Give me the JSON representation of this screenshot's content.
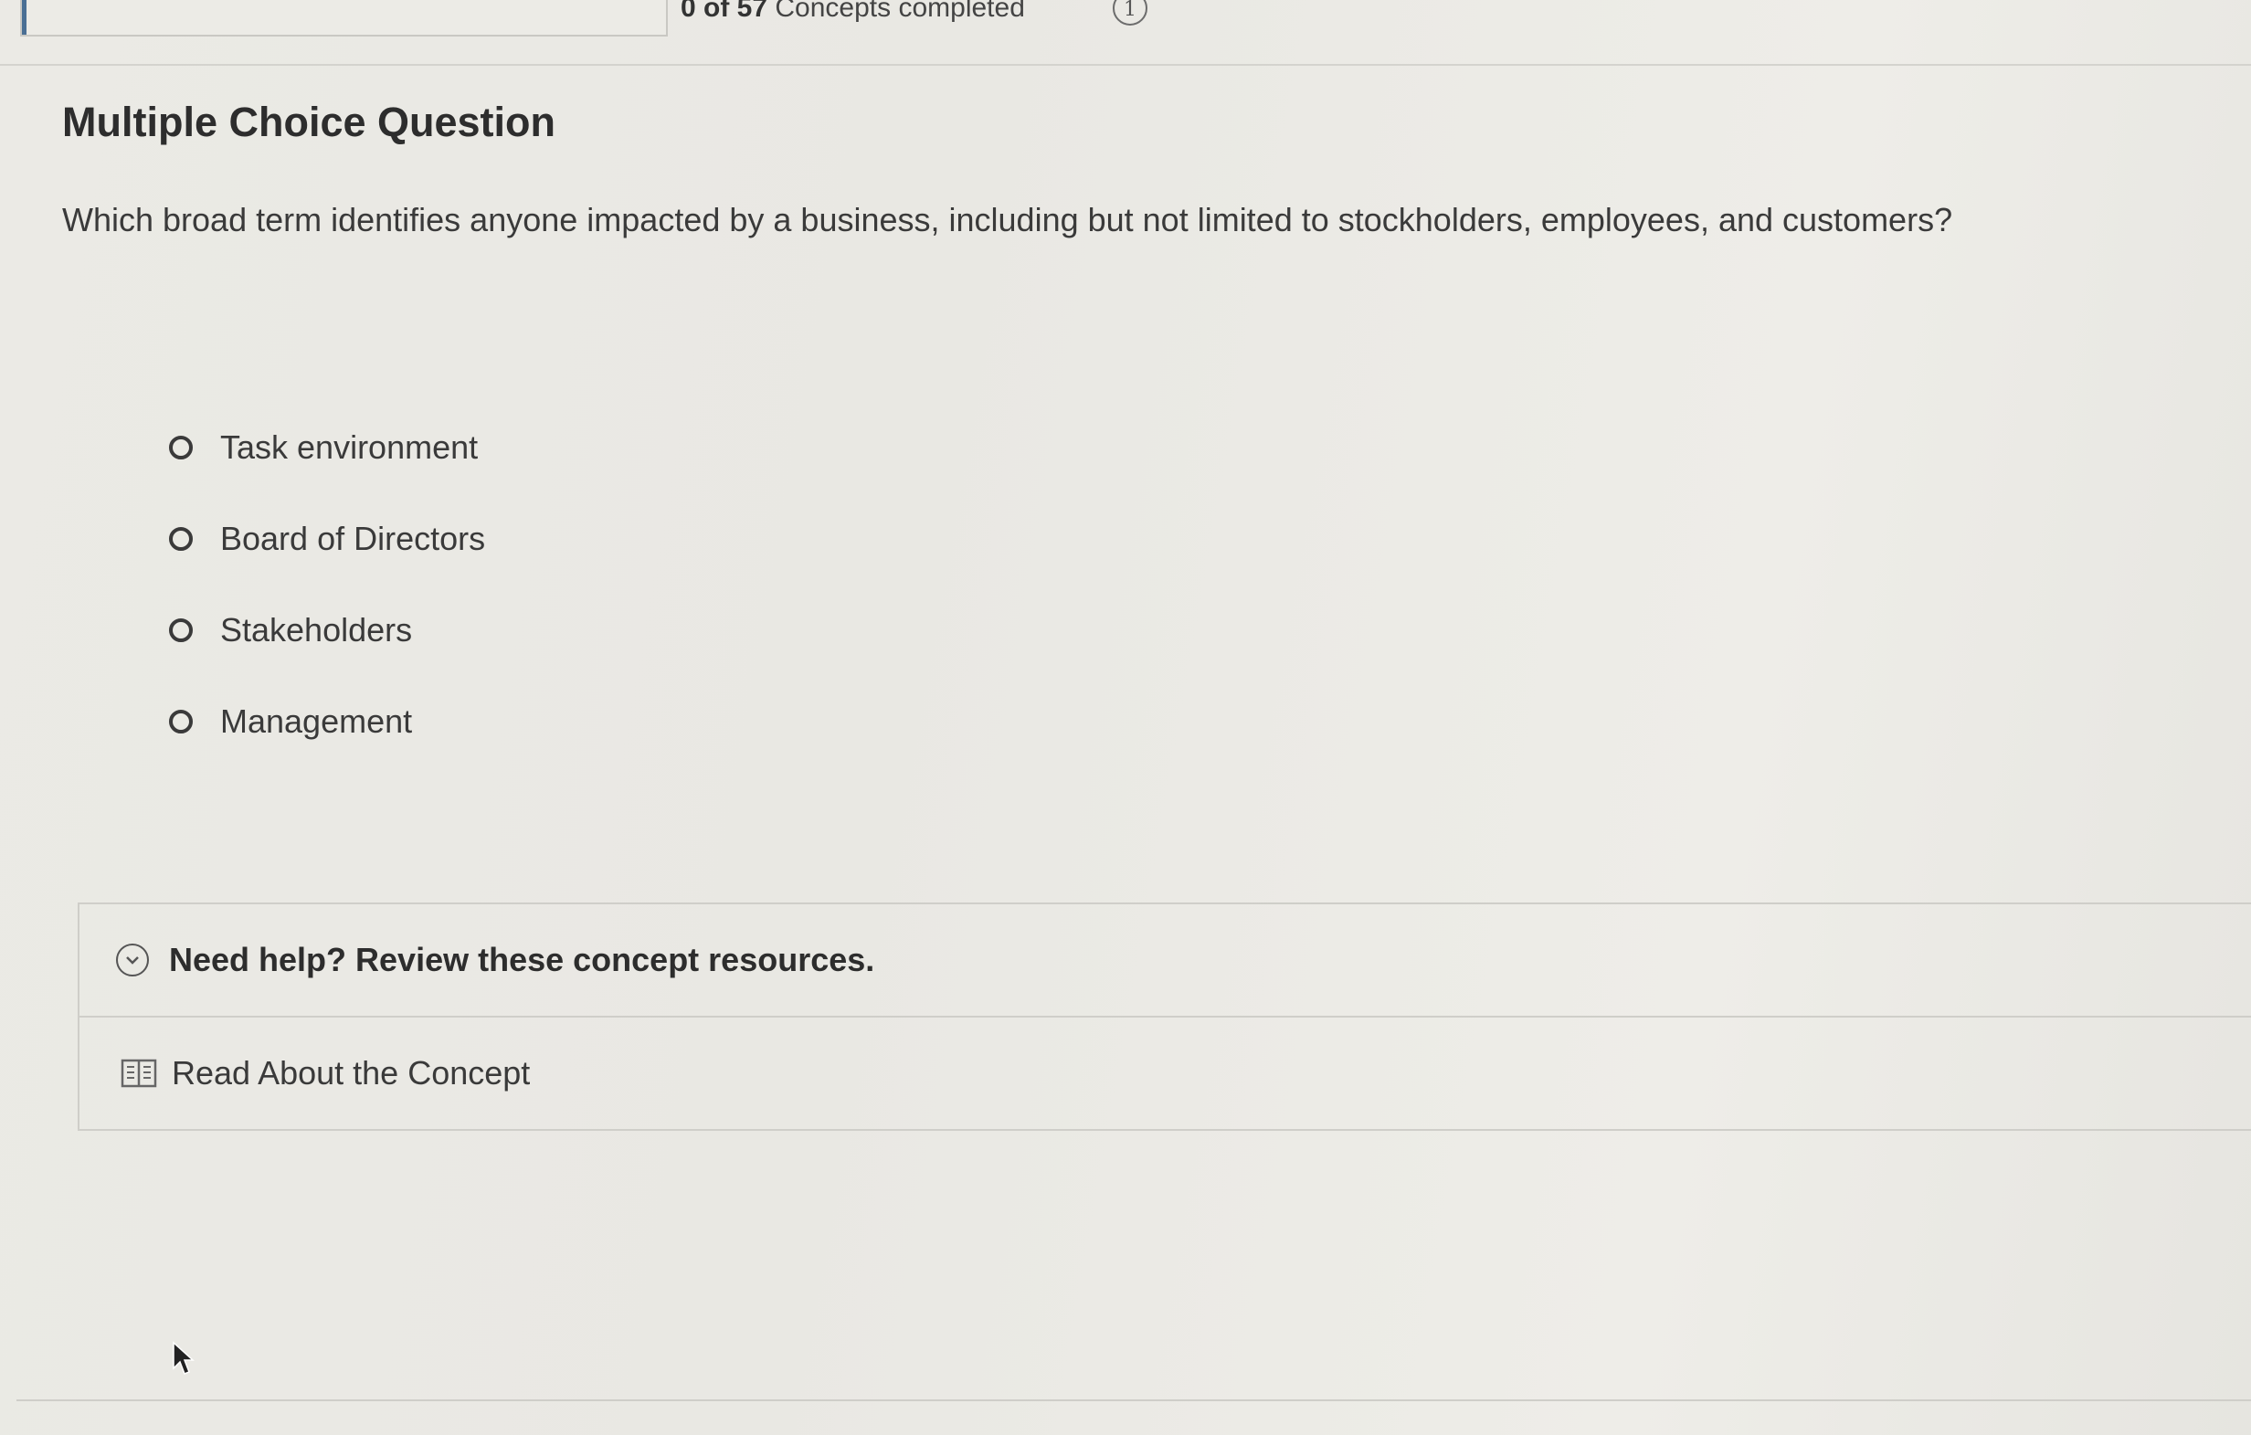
{
  "progress": {
    "count_text": "0 of 57",
    "suffix_text": "Concepts completed",
    "fraction_completed": 0,
    "info_badge": "1"
  },
  "question": {
    "heading": "Multiple Choice Question",
    "text": "Which broad term identifies anyone impacted by a business, including but not limited to stockholders, employees, and customers?",
    "options": [
      {
        "label": "Task environment",
        "selected": false
      },
      {
        "label": "Board of Directors",
        "selected": false
      },
      {
        "label": "Stakeholders",
        "selected": false
      },
      {
        "label": "Management",
        "selected": false
      }
    ]
  },
  "help": {
    "title": "Need help? Review these concept resources.",
    "toggle_icon": "chevron-down-circle-icon",
    "resources": [
      {
        "label": "Read About the Concept",
        "icon": "book-icon"
      }
    ]
  },
  "colors": {
    "progress_fill": "#4a6f94",
    "background": "#e9e8e3",
    "text": "#2d2d2d"
  }
}
